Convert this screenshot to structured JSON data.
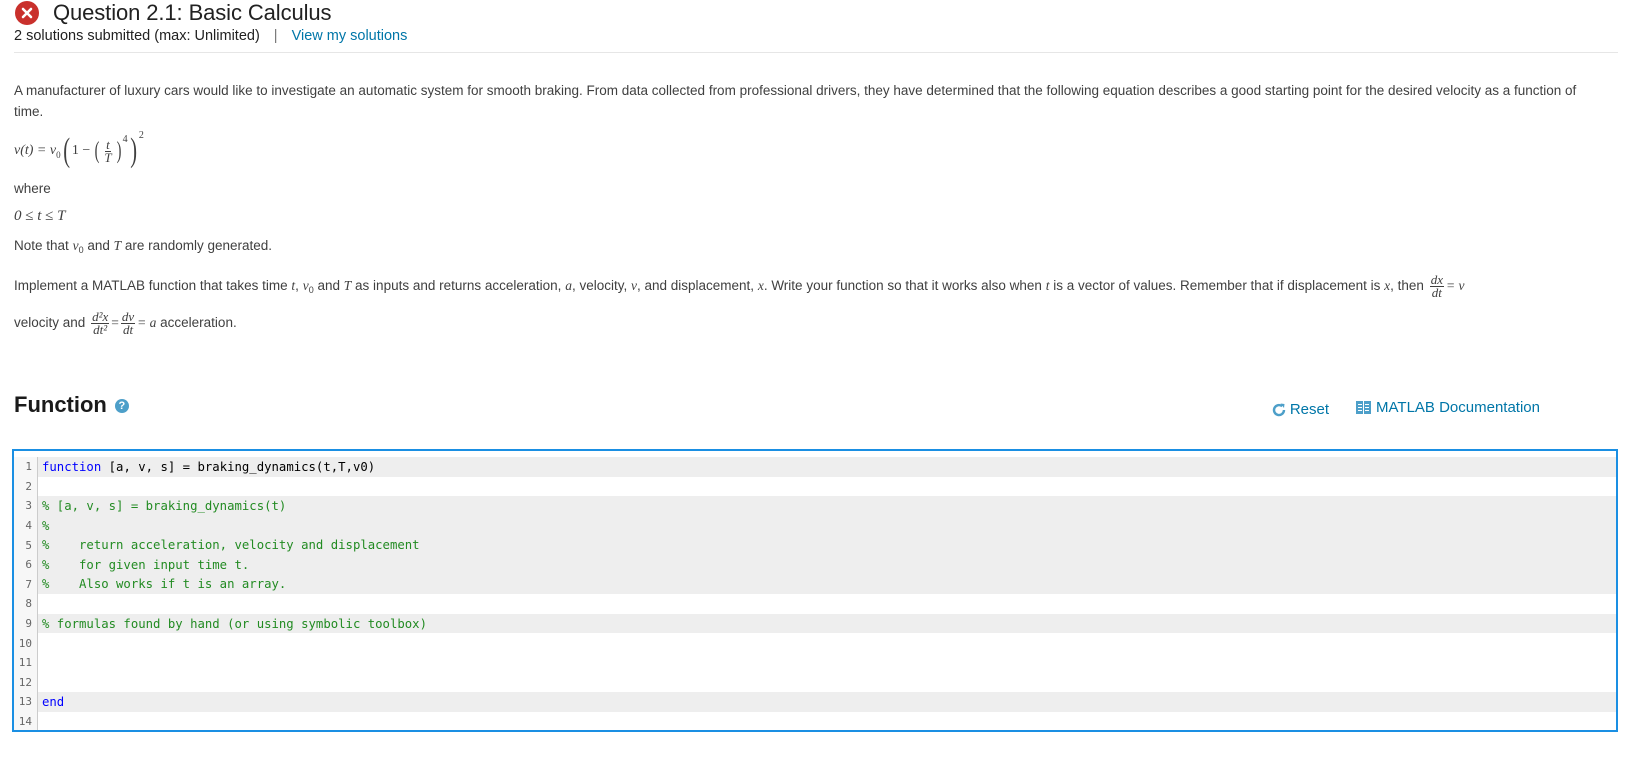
{
  "header": {
    "status_icon": "error-x-icon",
    "title": "Question 2.1: Basic Calculus",
    "submissions": "2 solutions submitted (max: Unlimited)",
    "separator": "|",
    "view_solutions_link": "View my solutions"
  },
  "description": {
    "intro": "A manufacturer of luxury cars would like to investigate an automatic system for smooth braking. From data collected from professional drivers, they have determined that the following equation describes a good starting point for the desired velocity as a function of time.",
    "equation": {
      "lhs": "v(t) = v",
      "sub0": "0",
      "one_minus": "1 −",
      "frac_num": "t",
      "frac_den": "T",
      "inner_exp": "4",
      "outer_exp": "2"
    },
    "where": "where",
    "range": "0 ≤ t ≤ T",
    "note_pre": "Note that",
    "note_v": "v",
    "note_sub": "0",
    "note_and": "and",
    "note_T": "T",
    "note_post": "are randomly generated.",
    "implement": {
      "p1": "Implement a MATLAB function that takes time",
      "t": "t",
      "comma": ",",
      "v": "v",
      "sub": "0",
      "and": "and",
      "T": "T",
      "p2": "as inputs and returns acceleration,",
      "a": "a",
      "p3": ", velocity,",
      "vel": "v",
      "p4": ", and displacement,",
      "x": "x",
      "p5": ". Write your function so that it works also when",
      "t2": "t",
      "p6": "is a vector of values. Remember that if displacement is",
      "x2": "x",
      "p7": ", then",
      "dx": "dx",
      "dt": "dt",
      "eq_v": "= v",
      "p8": "velocity and",
      "d2x": "d²x",
      "dt2": "dt²",
      "eq": "=",
      "dv": "dv",
      "dt3": "dt",
      "eq_a": "= a",
      "p9": "acceleration."
    }
  },
  "function_section": {
    "title": "Function",
    "help_icon": "question-circle-icon",
    "reset_label": "Reset",
    "reset_icon": "refresh-icon",
    "docs_label": "MATLAB Documentation",
    "docs_icon": "book-icon"
  },
  "editor": {
    "lines": [
      {
        "n": "1",
        "text": "",
        "kw": "function",
        "rest": " [a, v, s] = braking_dynamics(t,T,v0)",
        "type": "code",
        "shaded": true
      },
      {
        "n": "2",
        "text": "",
        "type": "blank",
        "shaded": false
      },
      {
        "n": "3",
        "text": "% [a, v, s] = braking_dynamics(t)",
        "type": "comment",
        "shaded": true
      },
      {
        "n": "4",
        "text": "%",
        "type": "comment",
        "shaded": true
      },
      {
        "n": "5",
        "text": "%    return acceleration, velocity and displacement",
        "type": "comment",
        "shaded": true
      },
      {
        "n": "6",
        "text": "%    for given input time t.",
        "type": "comment",
        "shaded": true
      },
      {
        "n": "7",
        "text": "%    Also works if t is an array.",
        "type": "comment",
        "shaded": true
      },
      {
        "n": "8",
        "text": "",
        "type": "blank",
        "shaded": false
      },
      {
        "n": "9",
        "text": "% formulas found by hand (or using symbolic toolbox)",
        "type": "comment",
        "shaded": true
      },
      {
        "n": "10",
        "text": "",
        "type": "blank",
        "shaded": false
      },
      {
        "n": "11",
        "text": "",
        "type": "blank",
        "shaded": false
      },
      {
        "n": "12",
        "text": "",
        "type": "blank",
        "shaded": false
      },
      {
        "n": "13",
        "text": "",
        "kw": "end",
        "rest": "",
        "type": "code",
        "shaded": true
      },
      {
        "n": "14",
        "text": "",
        "type": "blank",
        "shaded": false
      }
    ]
  },
  "colors": {
    "accent": "#0076a8",
    "error": "#c9302c",
    "editor_border": "#1a8fe3",
    "keyword": "#0000ff",
    "comment": "#228b22"
  }
}
